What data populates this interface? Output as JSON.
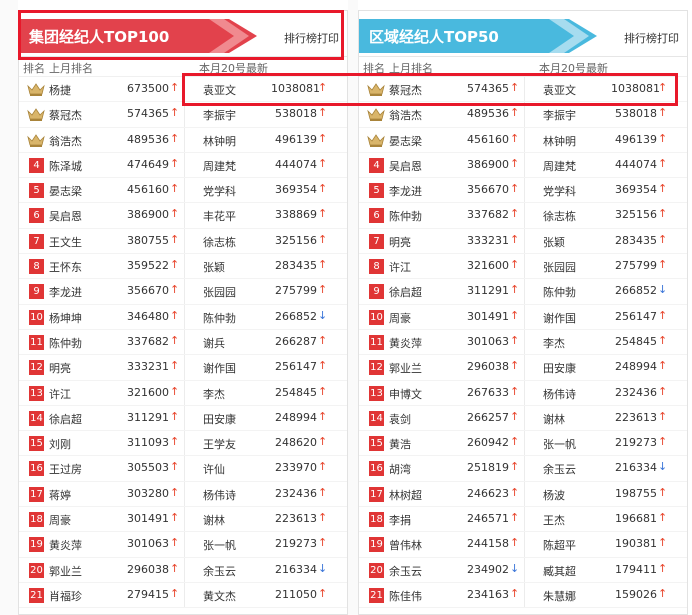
{
  "colors": {
    "left_banner": "#e2424c",
    "right_banner": "#49b9de",
    "rank_badge": "#e03535",
    "highlight": "#e8182a",
    "arrow_up": "#e8452c",
    "arrow_down": "#3a74d8"
  },
  "left": {
    "title": "集团经纪人TOP100",
    "print_label": "排行榜打印",
    "col_rank": "排名",
    "col_last": "上月排名",
    "col_now": "本月20号最新",
    "rows": [
      {
        "rank": "1",
        "crown": true,
        "name1": "杨捷",
        "val1": "673500",
        "dir1": "up",
        "name2": "袁亚文",
        "val2": "1038081",
        "dir2": "up"
      },
      {
        "rank": "2",
        "crown": true,
        "name1": "蔡冠杰",
        "val1": "574365",
        "dir1": "up",
        "name2": "李振宇",
        "val2": "538018",
        "dir2": "up"
      },
      {
        "rank": "3",
        "crown": true,
        "name1": "翁浩杰",
        "val1": "489536",
        "dir1": "up",
        "name2": "林钟明",
        "val2": "496139",
        "dir2": "up"
      },
      {
        "rank": "4",
        "crown": false,
        "name1": "陈泽城",
        "val1": "474649",
        "dir1": "up",
        "name2": "周建梵",
        "val2": "444074",
        "dir2": "up"
      },
      {
        "rank": "5",
        "crown": false,
        "name1": "晏志梁",
        "val1": "456160",
        "dir1": "up",
        "name2": "党学科",
        "val2": "369354",
        "dir2": "up"
      },
      {
        "rank": "6",
        "crown": false,
        "name1": "吴启恩",
        "val1": "386900",
        "dir1": "up",
        "name2": "丰花平",
        "val2": "338869",
        "dir2": "up"
      },
      {
        "rank": "7",
        "crown": false,
        "name1": "王文生",
        "val1": "380755",
        "dir1": "up",
        "name2": "徐志栋",
        "val2": "325156",
        "dir2": "up"
      },
      {
        "rank": "8",
        "crown": false,
        "name1": "王怀东",
        "val1": "359522",
        "dir1": "up",
        "name2": "张颖",
        "val2": "283435",
        "dir2": "up"
      },
      {
        "rank": "9",
        "crown": false,
        "name1": "李龙进",
        "val1": "356670",
        "dir1": "up",
        "name2": "张园园",
        "val2": "275799",
        "dir2": "up"
      },
      {
        "rank": "10",
        "crown": false,
        "name1": "杨坤坤",
        "val1": "346480",
        "dir1": "up",
        "name2": "陈仲勃",
        "val2": "266852",
        "dir2": "down"
      },
      {
        "rank": "11",
        "crown": false,
        "name1": "陈仲勃",
        "val1": "337682",
        "dir1": "up",
        "name2": "谢兵",
        "val2": "266287",
        "dir2": "up"
      },
      {
        "rank": "12",
        "crown": false,
        "name1": "明亮",
        "val1": "333231",
        "dir1": "up",
        "name2": "谢作国",
        "val2": "256147",
        "dir2": "up"
      },
      {
        "rank": "13",
        "crown": false,
        "name1": "许江",
        "val1": "321600",
        "dir1": "up",
        "name2": "李杰",
        "val2": "254845",
        "dir2": "up"
      },
      {
        "rank": "14",
        "crown": false,
        "name1": "徐启超",
        "val1": "311291",
        "dir1": "up",
        "name2": "田安康",
        "val2": "248994",
        "dir2": "up"
      },
      {
        "rank": "15",
        "crown": false,
        "name1": "刘刚",
        "val1": "311093",
        "dir1": "up",
        "name2": "王学友",
        "val2": "248620",
        "dir2": "up"
      },
      {
        "rank": "16",
        "crown": false,
        "name1": "王过房",
        "val1": "305503",
        "dir1": "up",
        "name2": "许仙",
        "val2": "233970",
        "dir2": "up"
      },
      {
        "rank": "17",
        "crown": false,
        "name1": "蒋婷",
        "val1": "303280",
        "dir1": "up",
        "name2": "杨伟诗",
        "val2": "232436",
        "dir2": "up"
      },
      {
        "rank": "18",
        "crown": false,
        "name1": "周豪",
        "val1": "301491",
        "dir1": "up",
        "name2": "谢林",
        "val2": "223613",
        "dir2": "up"
      },
      {
        "rank": "19",
        "crown": false,
        "name1": "黄炎萍",
        "val1": "301063",
        "dir1": "up",
        "name2": "张一帆",
        "val2": "219273",
        "dir2": "up"
      },
      {
        "rank": "20",
        "crown": false,
        "name1": "郭业兰",
        "val1": "296038",
        "dir1": "up",
        "name2": "余玉云",
        "val2": "216334",
        "dir2": "down"
      },
      {
        "rank": "21",
        "crown": false,
        "name1": "肖福珍",
        "val1": "279415",
        "dir1": "up",
        "name2": "黄文杰",
        "val2": "211050",
        "dir2": "up"
      }
    ]
  },
  "right": {
    "title": "区域经纪人TOP50",
    "print_label": "排行榜打印",
    "col_rank": "排名",
    "col_last": "上月排名",
    "col_now": "本月20号最新",
    "rows": [
      {
        "rank": "1",
        "crown": true,
        "name1": "蔡冠杰",
        "val1": "574365",
        "dir1": "up",
        "name2": "袁亚文",
        "val2": "1038081",
        "dir2": "up"
      },
      {
        "rank": "2",
        "crown": true,
        "name1": "翁浩杰",
        "val1": "489536",
        "dir1": "up",
        "name2": "李振宇",
        "val2": "538018",
        "dir2": "up"
      },
      {
        "rank": "3",
        "crown": true,
        "name1": "晏志梁",
        "val1": "456160",
        "dir1": "up",
        "name2": "林钟明",
        "val2": "496139",
        "dir2": "up"
      },
      {
        "rank": "4",
        "crown": false,
        "name1": "吴启恩",
        "val1": "386900",
        "dir1": "up",
        "name2": "周建梵",
        "val2": "444074",
        "dir2": "up"
      },
      {
        "rank": "5",
        "crown": false,
        "name1": "李龙进",
        "val1": "356670",
        "dir1": "up",
        "name2": "党学科",
        "val2": "369354",
        "dir2": "up"
      },
      {
        "rank": "6",
        "crown": false,
        "name1": "陈仲勃",
        "val1": "337682",
        "dir1": "up",
        "name2": "徐志栋",
        "val2": "325156",
        "dir2": "up"
      },
      {
        "rank": "7",
        "crown": false,
        "name1": "明亮",
        "val1": "333231",
        "dir1": "up",
        "name2": "张颖",
        "val2": "283435",
        "dir2": "up"
      },
      {
        "rank": "8",
        "crown": false,
        "name1": "许江",
        "val1": "321600",
        "dir1": "up",
        "name2": "张园园",
        "val2": "275799",
        "dir2": "up"
      },
      {
        "rank": "9",
        "crown": false,
        "name1": "徐启超",
        "val1": "311291",
        "dir1": "up",
        "name2": "陈仲勃",
        "val2": "266852",
        "dir2": "down"
      },
      {
        "rank": "10",
        "crown": false,
        "name1": "周豪",
        "val1": "301491",
        "dir1": "up",
        "name2": "谢作国",
        "val2": "256147",
        "dir2": "up"
      },
      {
        "rank": "11",
        "crown": false,
        "name1": "黄炎萍",
        "val1": "301063",
        "dir1": "up",
        "name2": "李杰",
        "val2": "254845",
        "dir2": "up"
      },
      {
        "rank": "12",
        "crown": false,
        "name1": "郭业兰",
        "val1": "296038",
        "dir1": "up",
        "name2": "田安康",
        "val2": "248994",
        "dir2": "up"
      },
      {
        "rank": "13",
        "crown": false,
        "name1": "申博文",
        "val1": "267633",
        "dir1": "up",
        "name2": "杨伟诗",
        "val2": "232436",
        "dir2": "up"
      },
      {
        "rank": "14",
        "crown": false,
        "name1": "袁剑",
        "val1": "266257",
        "dir1": "up",
        "name2": "谢林",
        "val2": "223613",
        "dir2": "up"
      },
      {
        "rank": "15",
        "crown": false,
        "name1": "黄浩",
        "val1": "260942",
        "dir1": "up",
        "name2": "张一帆",
        "val2": "219273",
        "dir2": "up"
      },
      {
        "rank": "16",
        "crown": false,
        "name1": "胡湾",
        "val1": "251819",
        "dir1": "up",
        "name2": "余玉云",
        "val2": "216334",
        "dir2": "down"
      },
      {
        "rank": "17",
        "crown": false,
        "name1": "林树超",
        "val1": "246623",
        "dir1": "up",
        "name2": "杨波",
        "val2": "198755",
        "dir2": "up"
      },
      {
        "rank": "18",
        "crown": false,
        "name1": "李捐",
        "val1": "246571",
        "dir1": "up",
        "name2": "王杰",
        "val2": "196681",
        "dir2": "up"
      },
      {
        "rank": "19",
        "crown": false,
        "name1": "曾伟林",
        "val1": "244158",
        "dir1": "up",
        "name2": "陈超平",
        "val2": "190381",
        "dir2": "up"
      },
      {
        "rank": "20",
        "crown": false,
        "name1": "余玉云",
        "val1": "234902",
        "dir1": "down",
        "name2": "臧其超",
        "val2": "179411",
        "dir2": "up"
      },
      {
        "rank": "21",
        "crown": false,
        "name1": "陈佳伟",
        "val1": "234163",
        "dir1": "up",
        "name2": "朱慧娜",
        "val2": "159026",
        "dir2": "up"
      }
    ]
  }
}
